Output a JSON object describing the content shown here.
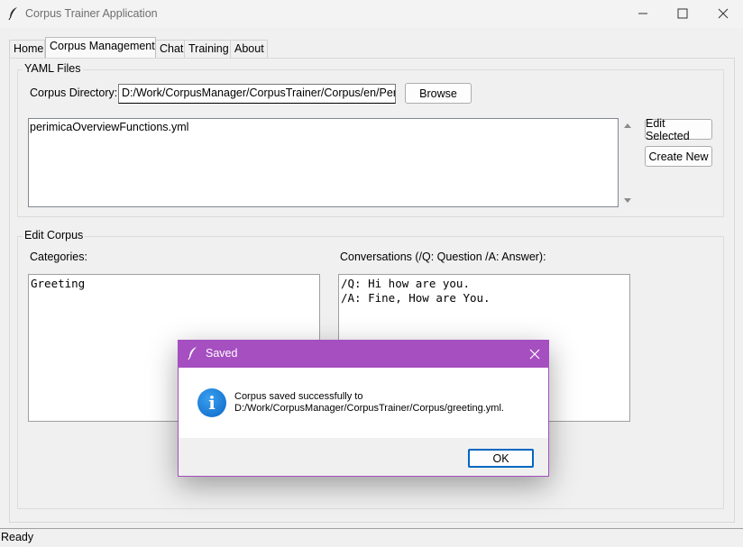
{
  "window": {
    "title": "Corpus Trainer Application",
    "icon": "feather-icon",
    "controls": [
      "minimize-icon",
      "maximize-icon",
      "close-icon"
    ]
  },
  "tabs": [
    {
      "label": "Home",
      "active": false
    },
    {
      "label": "Corpus Management",
      "active": true
    },
    {
      "label": "Chat",
      "active": false
    },
    {
      "label": "Training",
      "active": false
    },
    {
      "label": "About",
      "active": false
    }
  ],
  "yaml": {
    "frame_label": "YAML Files",
    "dir_label": "Corpus Directory:",
    "dir_value": "D:/Work/CorpusManager/CorpusTrainer/Corpus/en/Peri",
    "browse_label": "Browse",
    "files": [
      "perimicaOverviewFunctions.yml"
    ],
    "edit_selected_label": "Edit Selected",
    "create_new_label": "Create New"
  },
  "edit": {
    "frame_label": "Edit Corpus",
    "categories_label": "Categories:",
    "categories_text": "Greeting",
    "conversations_label": "Conversations (/Q: Question /A: Answer):",
    "conversations_text": "/Q: Hi how are you.\n/A: Fine, How are You."
  },
  "status": {
    "text": "Ready"
  },
  "dialog": {
    "title": "Saved",
    "message_line1": "Corpus saved successfully to",
    "message_line2": "D:/Work/CorpusManager/CorpusTrainer/Corpus/greeting.yml.",
    "ok_label": "OK",
    "icon": "info-icon",
    "accent": "#a64fc0"
  }
}
